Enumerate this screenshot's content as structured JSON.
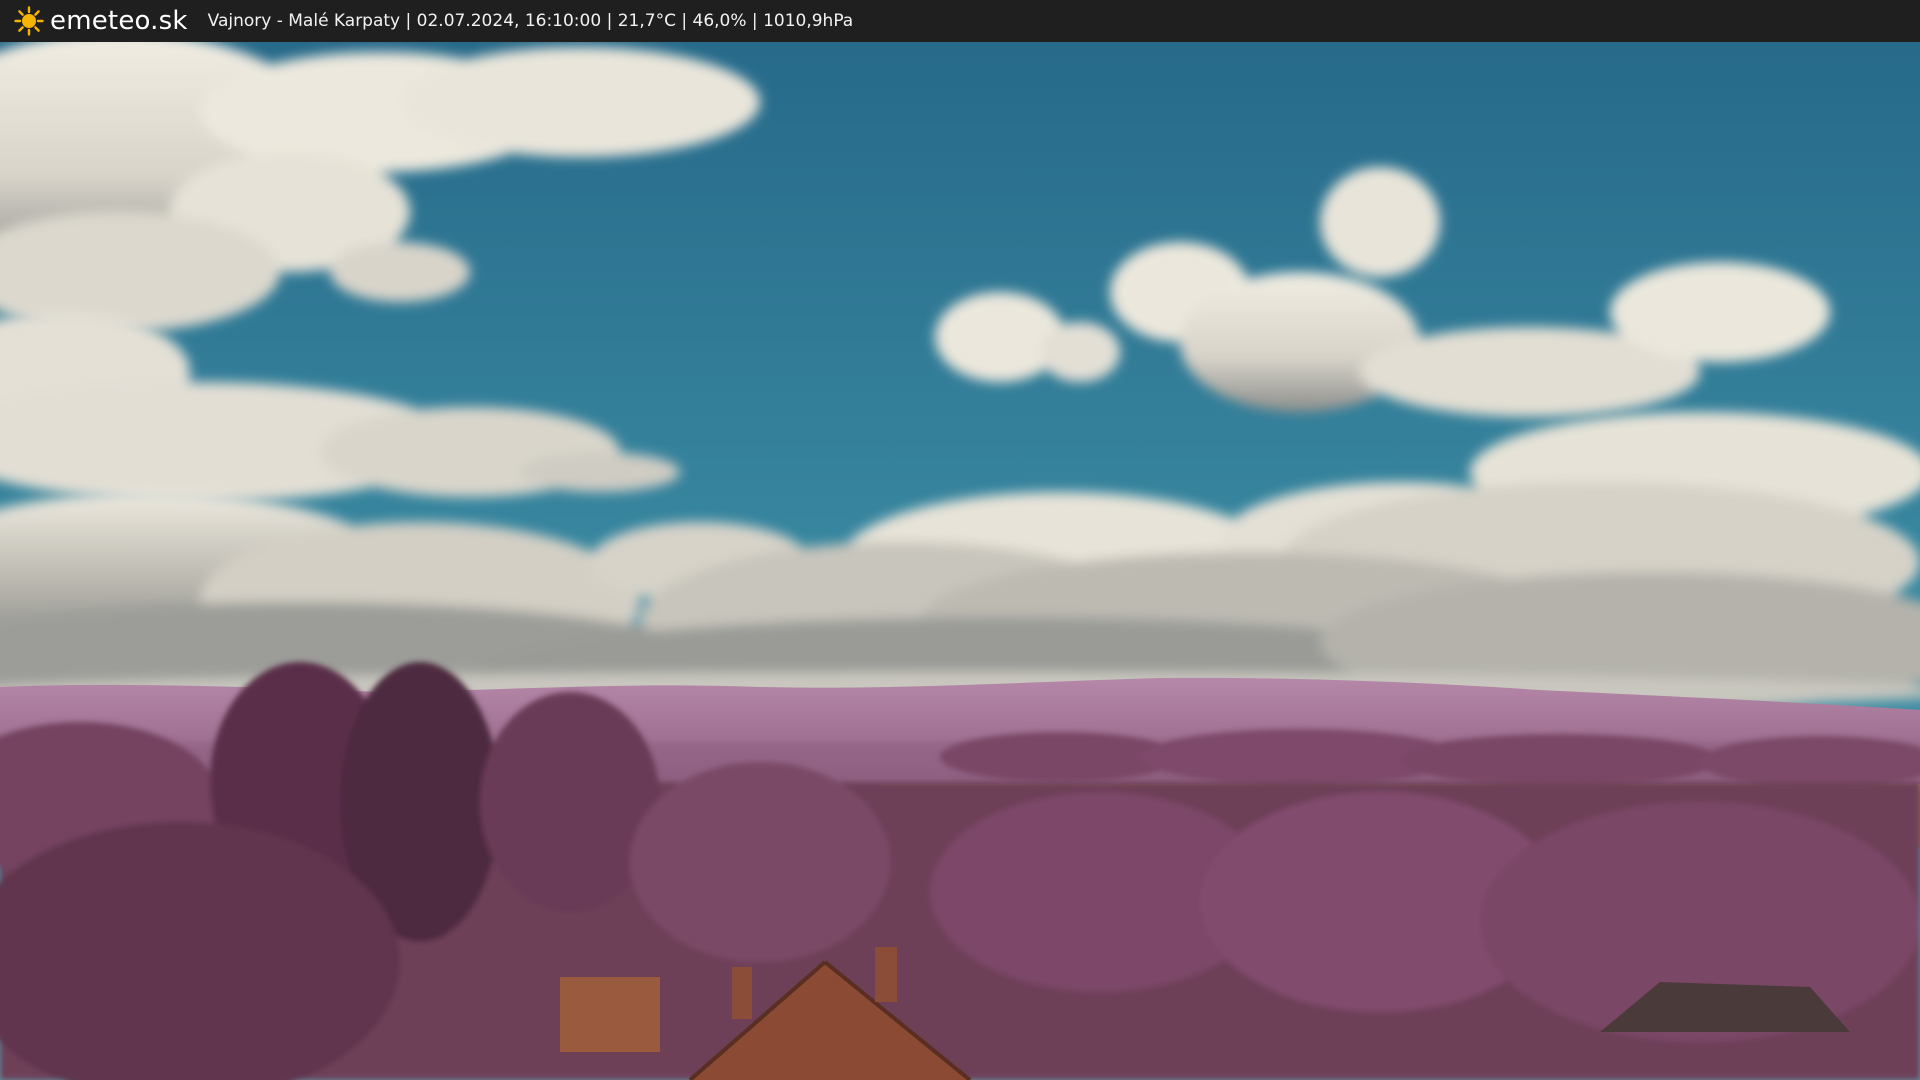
{
  "header": {
    "brand": "emeteo.sk",
    "logo_icon": "sun-icon",
    "location": "Vajnory - Malé Karpaty",
    "datetime": "02.07.2024, 16:10:00",
    "temperature": "21,7°C",
    "humidity": "46,0%",
    "pressure": "1010,9hPa",
    "separator": " | "
  },
  "colors": {
    "bar": "#1f1f1f",
    "sun": "#f5b400",
    "sky_top": "#2f7290",
    "sky_bottom": "#3e8ea3",
    "cloud": "#ece8de",
    "cloud_shade": "#8a8c8a",
    "hill": "#9c6a8e",
    "foliage": "#6e3f58",
    "field": "#8a6a4a",
    "roof": "#8a4a34"
  }
}
